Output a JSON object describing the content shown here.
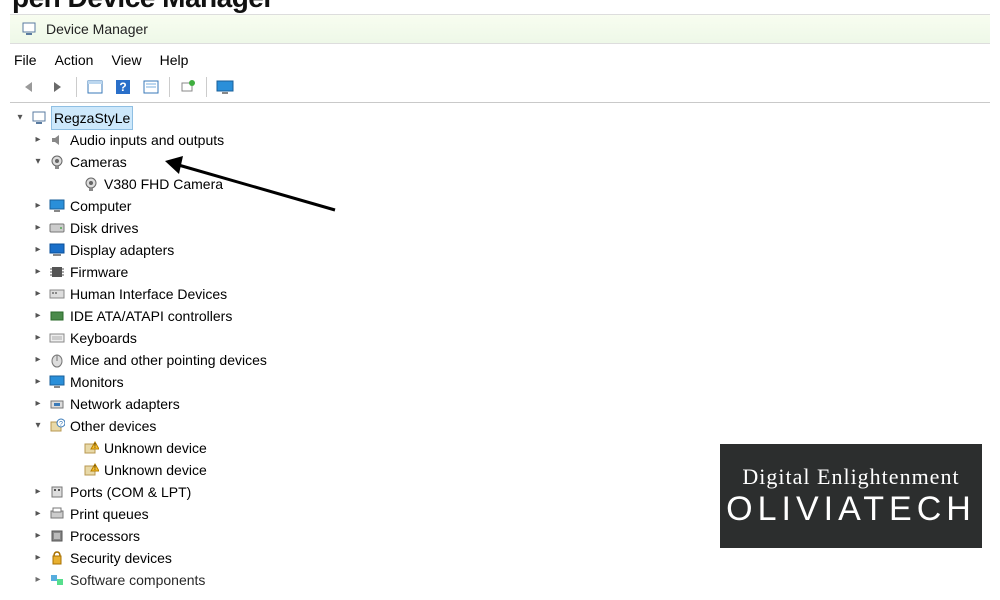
{
  "page_heading": "pen Device Manager",
  "window_title": "Device Manager",
  "menu": {
    "file": "File",
    "action": "Action",
    "view": "View",
    "help": "Help"
  },
  "tree": {
    "root": {
      "label": "RegzaStyLe"
    },
    "nodes": [
      {
        "label": "Audio inputs and outputs",
        "icon": "speaker"
      },
      {
        "label": "Cameras",
        "icon": "camera",
        "expanded": true
      },
      {
        "label": "Computer",
        "icon": "computer"
      },
      {
        "label": "Disk drives",
        "icon": "disk"
      },
      {
        "label": "Display adapters",
        "icon": "display"
      },
      {
        "label": "Firmware",
        "icon": "chip"
      },
      {
        "label": "Human Interface Devices",
        "icon": "hid"
      },
      {
        "label": "IDE ATA/ATAPI controllers",
        "icon": "ide"
      },
      {
        "label": "Keyboards",
        "icon": "keyboard"
      },
      {
        "label": "Mice and other pointing devices",
        "icon": "mouse"
      },
      {
        "label": "Monitors",
        "icon": "monitor"
      },
      {
        "label": "Network adapters",
        "icon": "network"
      },
      {
        "label": "Other devices",
        "icon": "other",
        "expanded": true
      },
      {
        "label": "Ports (COM & LPT)",
        "icon": "ports"
      },
      {
        "label": "Print queues",
        "icon": "printer"
      },
      {
        "label": "Processors",
        "icon": "cpu"
      },
      {
        "label": "Security devices",
        "icon": "security"
      },
      {
        "label": "Software components",
        "icon": "software"
      }
    ],
    "camera_child": {
      "label": "V380 FHD Camera"
    },
    "other_children": [
      {
        "label": "Unknown device"
      },
      {
        "label": "Unknown device"
      }
    ]
  },
  "watermark": {
    "line1": "Digital Enlightenment",
    "line2": "OLIVIATECH"
  }
}
